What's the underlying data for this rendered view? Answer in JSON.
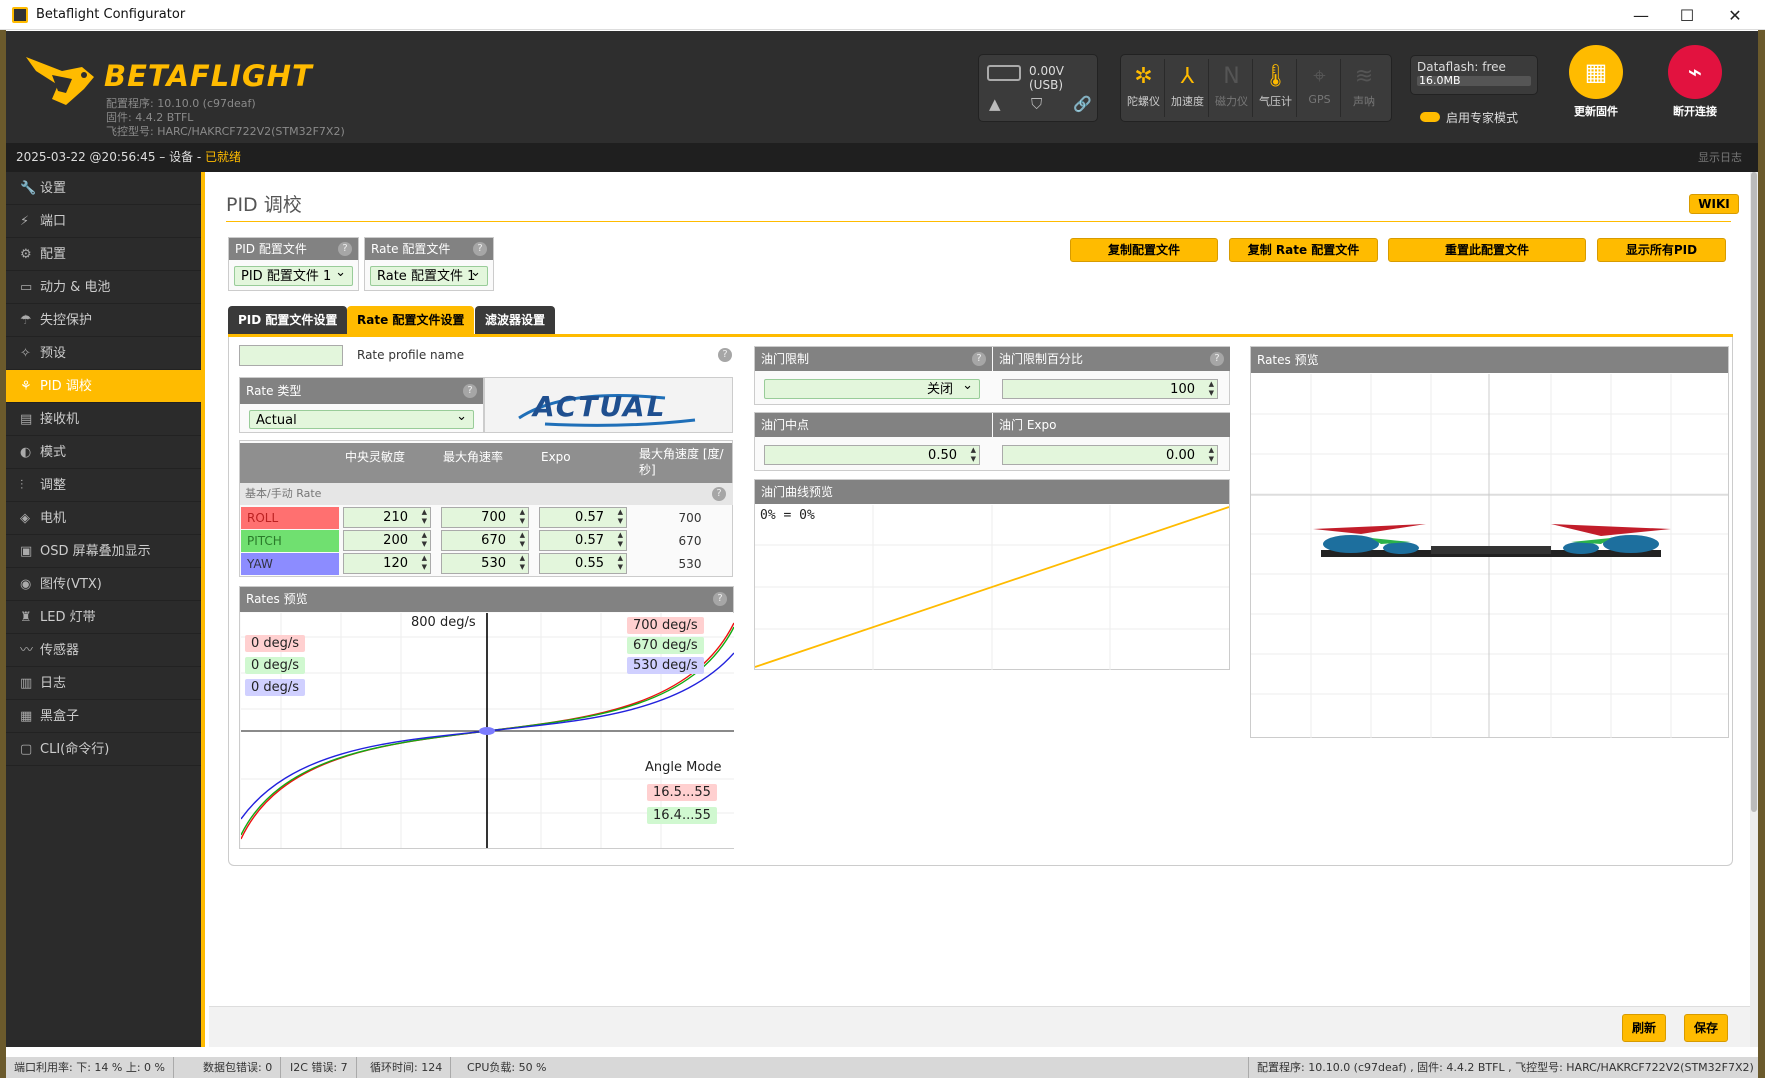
{
  "window": {
    "title": "Betaflight Configurator",
    "minimize": "—",
    "maximize": "☐",
    "close": "✕"
  },
  "header": {
    "logo_text": "BETAFLIGHT",
    "configurator_version": "配置程序: 10.10.0 (c97deaf)",
    "firmware_version": "固件: 4.4.2 BTFL",
    "board": "飞控型号: HARC/HAKRCF722V2(STM32F7X2)",
    "battery_voltage": "0.00V (USB)",
    "sensors": [
      {
        "label": "陀螺仪",
        "icon": "gyro-icon",
        "active": true
      },
      {
        "label": "加速度",
        "icon": "accelerometer-icon",
        "active": true
      },
      {
        "label": "磁力仪",
        "icon": "magnetometer-icon",
        "active": false
      },
      {
        "label": "气压计",
        "icon": "barometer-icon",
        "active": true
      },
      {
        "label": "GPS",
        "icon": "gps-icon",
        "active": false
      },
      {
        "label": "声呐",
        "icon": "sonar-icon",
        "active": false
      }
    ],
    "dataflash_label": "Dataflash: free",
    "dataflash_size": "16.0MB",
    "expert_mode_label": "启用专家模式",
    "update_firmware_label": "更新固件",
    "disconnect_label": "断开连接",
    "accent_color": "#ffbb00",
    "disconnect_color": "#e2123f"
  },
  "status": {
    "datetime": "2025-03-22 @20:56:45",
    "separator": " – 设备 - ",
    "state": "已就绪",
    "show_log": "显示日志"
  },
  "sidebar": {
    "items": [
      {
        "label": "设置",
        "icon": "wrench-icon"
      },
      {
        "label": "端口",
        "icon": "plug-icon"
      },
      {
        "label": "配置",
        "icon": "gear-icon"
      },
      {
        "label": "动力 & 电池",
        "icon": "battery-icon"
      },
      {
        "label": "失控保护",
        "icon": "parachute-icon"
      },
      {
        "label": "预设",
        "icon": "magic-wand-icon"
      },
      {
        "label": "PID 调校",
        "icon": "pid-icon",
        "active": true
      },
      {
        "label": "接收机",
        "icon": "receiver-icon"
      },
      {
        "label": "模式",
        "icon": "switch-icon"
      },
      {
        "label": "调整",
        "icon": "sliders-icon"
      },
      {
        "label": "电机",
        "icon": "motor-icon"
      },
      {
        "label": "OSD 屏幕叠加显示",
        "icon": "osd-icon"
      },
      {
        "label": "图传(VTX)",
        "icon": "vtx-icon"
      },
      {
        "label": "LED 灯带",
        "icon": "led-icon"
      },
      {
        "label": "传感器",
        "icon": "sensor-icon"
      },
      {
        "label": "日志",
        "icon": "log-icon"
      },
      {
        "label": "黑盒子",
        "icon": "blackbox-icon"
      },
      {
        "label": "CLI(命令行)",
        "icon": "cli-icon"
      }
    ]
  },
  "page": {
    "title": "PID 调校",
    "wiki": "WIKI",
    "pid_profile_label": "PID 配置文件",
    "pid_profile_value": "PID 配置文件 1",
    "rate_profile_label": "Rate 配置文件",
    "rate_profile_value": "Rate 配置文件 1",
    "buttons": [
      "复制配置文件",
      "复制 Rate 配置文件",
      "重置此配置文件",
      "显示所有PID"
    ],
    "tabs": [
      "PID 配置文件设置",
      "Rate 配置文件设置",
      "滤波器设置"
    ],
    "rate_profile_name_label": "Rate profile name",
    "rate_profile_name_value": "",
    "rate_type_label": "Rate 类型",
    "rate_type_value": "Actual",
    "rate_logo_text": "ACTUAL",
    "rates_table": {
      "headers": [
        "中央灵敏度",
        "最大角速率",
        "Expo",
        "最大角速度 [度/秒]"
      ],
      "section": "基本/手动 Rate",
      "rows": [
        {
          "axis": "ROLL",
          "center": "210",
          "max_rate": "700",
          "expo": "0.57",
          "max_speed": "700",
          "color": "#ff7070"
        },
        {
          "axis": "PITCH",
          "center": "200",
          "max_rate": "670",
          "expo": "0.57",
          "max_speed": "670",
          "color": "#70e070"
        },
        {
          "axis": "YAW",
          "center": "120",
          "max_rate": "530",
          "expo": "0.55",
          "max_speed": "530",
          "color": "#8c8cff"
        }
      ]
    },
    "rates_preview_label": "Rates 预览",
    "graph": {
      "top_label": "800 deg/s",
      "current": [
        "0 deg/s",
        "0 deg/s",
        "0 deg/s"
      ],
      "max": [
        "700 deg/s",
        "670 deg/s",
        "530 deg/s"
      ],
      "angle_mode_label": "Angle Mode",
      "angle_values": [
        "16.5...55",
        "16.4...55"
      ]
    },
    "throttle_limit_label": "油门限制",
    "throttle_limit_value": "关闭",
    "throttle_limit_pct_label": "油门限制百分比",
    "throttle_limit_pct_value": "100",
    "throttle_mid_label": "油门中点",
    "throttle_mid_value": "0.50",
    "throttle_expo_label": "油门 Expo",
    "throttle_expo_value": "0.00",
    "throttle_curve_label": "油门曲线预览",
    "throttle_curve_readout": "0% = 0%",
    "rates_preview_3d_label": "Rates 预览",
    "refresh": "刷新",
    "save": "保存"
  },
  "footer": {
    "port_usage": "端口利用率:   下: 14 % 上: 0 %",
    "packet_error": "数据包错误: 0",
    "i2c_error": "I2C 错误: 7",
    "cycle_time": "循环时间: 124",
    "cpu_load": "CPU负载: 50 %",
    "version_info": "配置程序: 10.10.0 (c97deaf) , 固件: 4.4.2 BTFL , 飞控型号: HARC/HAKRCF722V2(STM32F7X2)"
  }
}
